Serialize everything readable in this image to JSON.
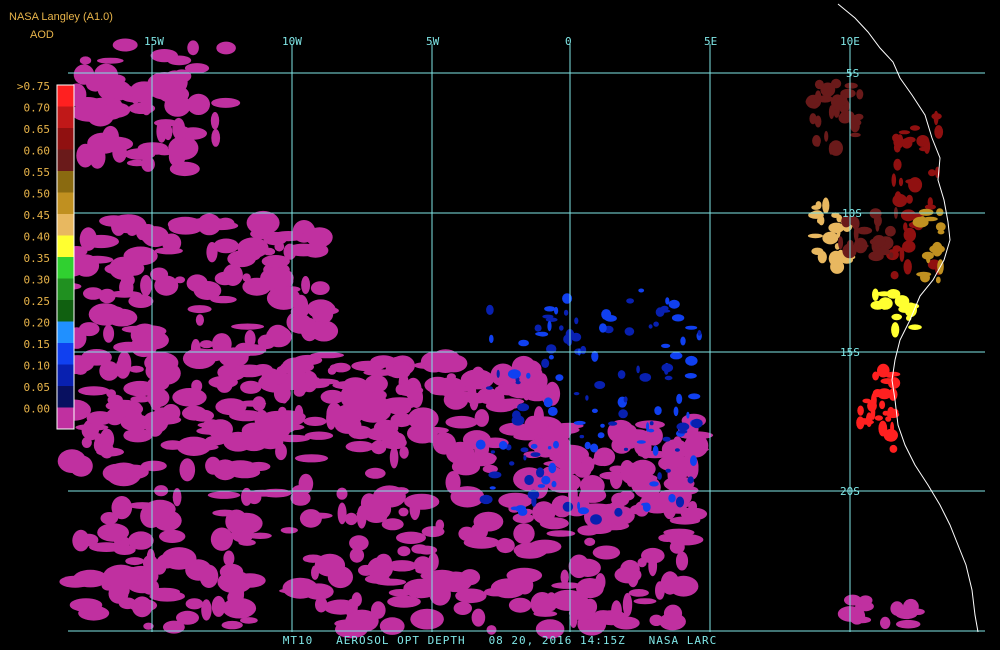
{
  "header": {
    "source": "NASA Langley (A1.0)",
    "parameter": "AOD"
  },
  "caption": {
    "product": "MT10",
    "name": "AEROSOL OPT DEPTH",
    "date": "08 20, 2016",
    "time": "14:15Z",
    "agency": "NASA LARC"
  },
  "legend": {
    "labels": [
      ">0.75",
      "0.70",
      "0.65",
      "0.60",
      "0.55",
      "0.50",
      "0.45",
      "0.40",
      "0.35",
      "0.30",
      "0.25",
      "0.20",
      "0.15",
      "0.10",
      "0.05",
      "0.00"
    ],
    "colors": [
      "#ff2020",
      "#c01818",
      "#901010",
      "#6a1a1a",
      "#8a6a10",
      "#c09020",
      "#e8b860",
      "#ffff30",
      "#30d030",
      "#209020",
      "#106010",
      "#2090ff",
      "#1040f0",
      "#0820b0",
      "#081060",
      "#c030a0"
    ]
  },
  "grid": {
    "longitudes": [
      "15W",
      "10W",
      "5W",
      "0",
      "5E",
      "10E"
    ],
    "latitudes": [
      "5S",
      "10S",
      "15S",
      "20S"
    ]
  },
  "colors": {
    "gridline": "#7fe6e6",
    "coastline": "#ffffff",
    "background": "#000000",
    "text": "#e8b44a"
  }
}
